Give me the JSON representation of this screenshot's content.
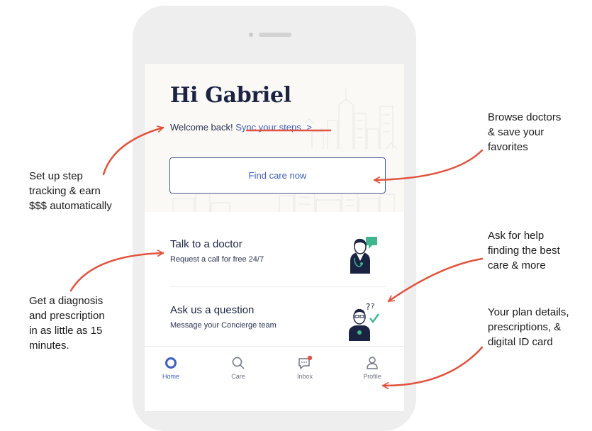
{
  "colors": {
    "navy": "#1b2343",
    "link_blue": "#3d5ec4",
    "annotation_red": "#e2533f",
    "phone_frame": "#eeeeee"
  },
  "app": {
    "greeting": "Hi Gabriel",
    "welcome_text": "Welcome back!",
    "sync_link": "Sync your steps",
    "sync_chevron": ">",
    "find_care_button": "Find care now",
    "cards": [
      {
        "title": "Talk to a doctor",
        "subtitle": "Request a call for free 24/7",
        "icon": "doctor-illustration"
      },
      {
        "title": "Ask us a question",
        "subtitle": "Message your Concierge team",
        "icon": "concierge-illustration"
      }
    ],
    "tabs": [
      {
        "label": "Home",
        "icon": "home-ring-icon",
        "active": true
      },
      {
        "label": "Care",
        "icon": "search-icon",
        "active": false
      },
      {
        "label": "Inbox",
        "icon": "message-icon",
        "active": false,
        "badge": true
      },
      {
        "label": "Profile",
        "icon": "person-icon",
        "active": false
      }
    ]
  },
  "annotations": {
    "steps": [
      "Set up step",
      "tracking & earn",
      "$$$ automatically"
    ],
    "diagnosis": [
      "Get a diagnosis",
      "and prescription",
      "in as little as 15",
      "minutes."
    ],
    "browse": [
      "Browse doctors",
      "& save your",
      "favorites"
    ],
    "help": [
      "Ask for help",
      "finding the best",
      "care & more"
    ],
    "plan": [
      "Your plan details,",
      "prescriptions, &",
      "digital ID card"
    ]
  }
}
